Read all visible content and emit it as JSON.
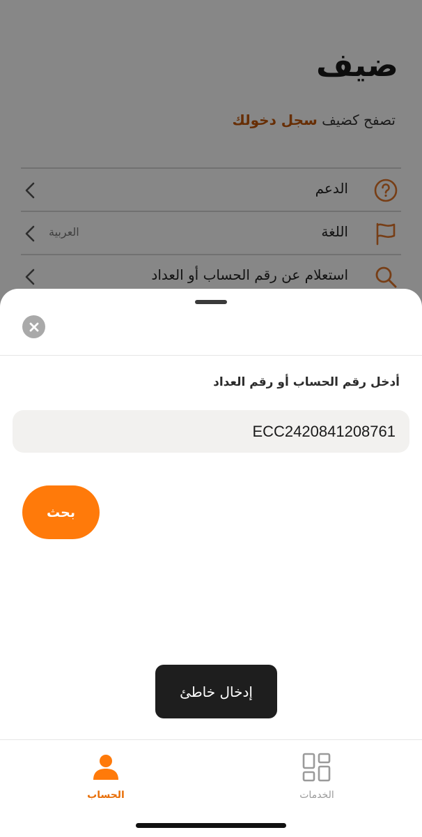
{
  "background": {
    "title": "ضيف",
    "subtitle_prefix": "تصفح كضيف",
    "subtitle_link": "سجل دخولك",
    "menu": [
      {
        "label": "الدعم",
        "value": "",
        "icon": "help-circle-icon"
      },
      {
        "label": "اللغة",
        "value": "العربية",
        "icon": "flag-icon"
      },
      {
        "label": "استعلام عن رقم الحساب أو العداد",
        "value": "",
        "icon": "search-icon"
      }
    ]
  },
  "sheet": {
    "close_icon": "close-icon",
    "field_label": "أدخل رقم الحساب أو رقم العداد",
    "field_value": "ECC2420841208761",
    "search_label": "بحث",
    "toast": "إدخال خاطئ"
  },
  "tabbar": {
    "account_label": "الحساب",
    "services_label": "الخدمات"
  },
  "colors": {
    "accent": "#ff7a0a",
    "accent_text": "#e86e06",
    "toast_bg": "#1e1e1e",
    "overlay": "rgba(0,0,0,0.47)"
  }
}
